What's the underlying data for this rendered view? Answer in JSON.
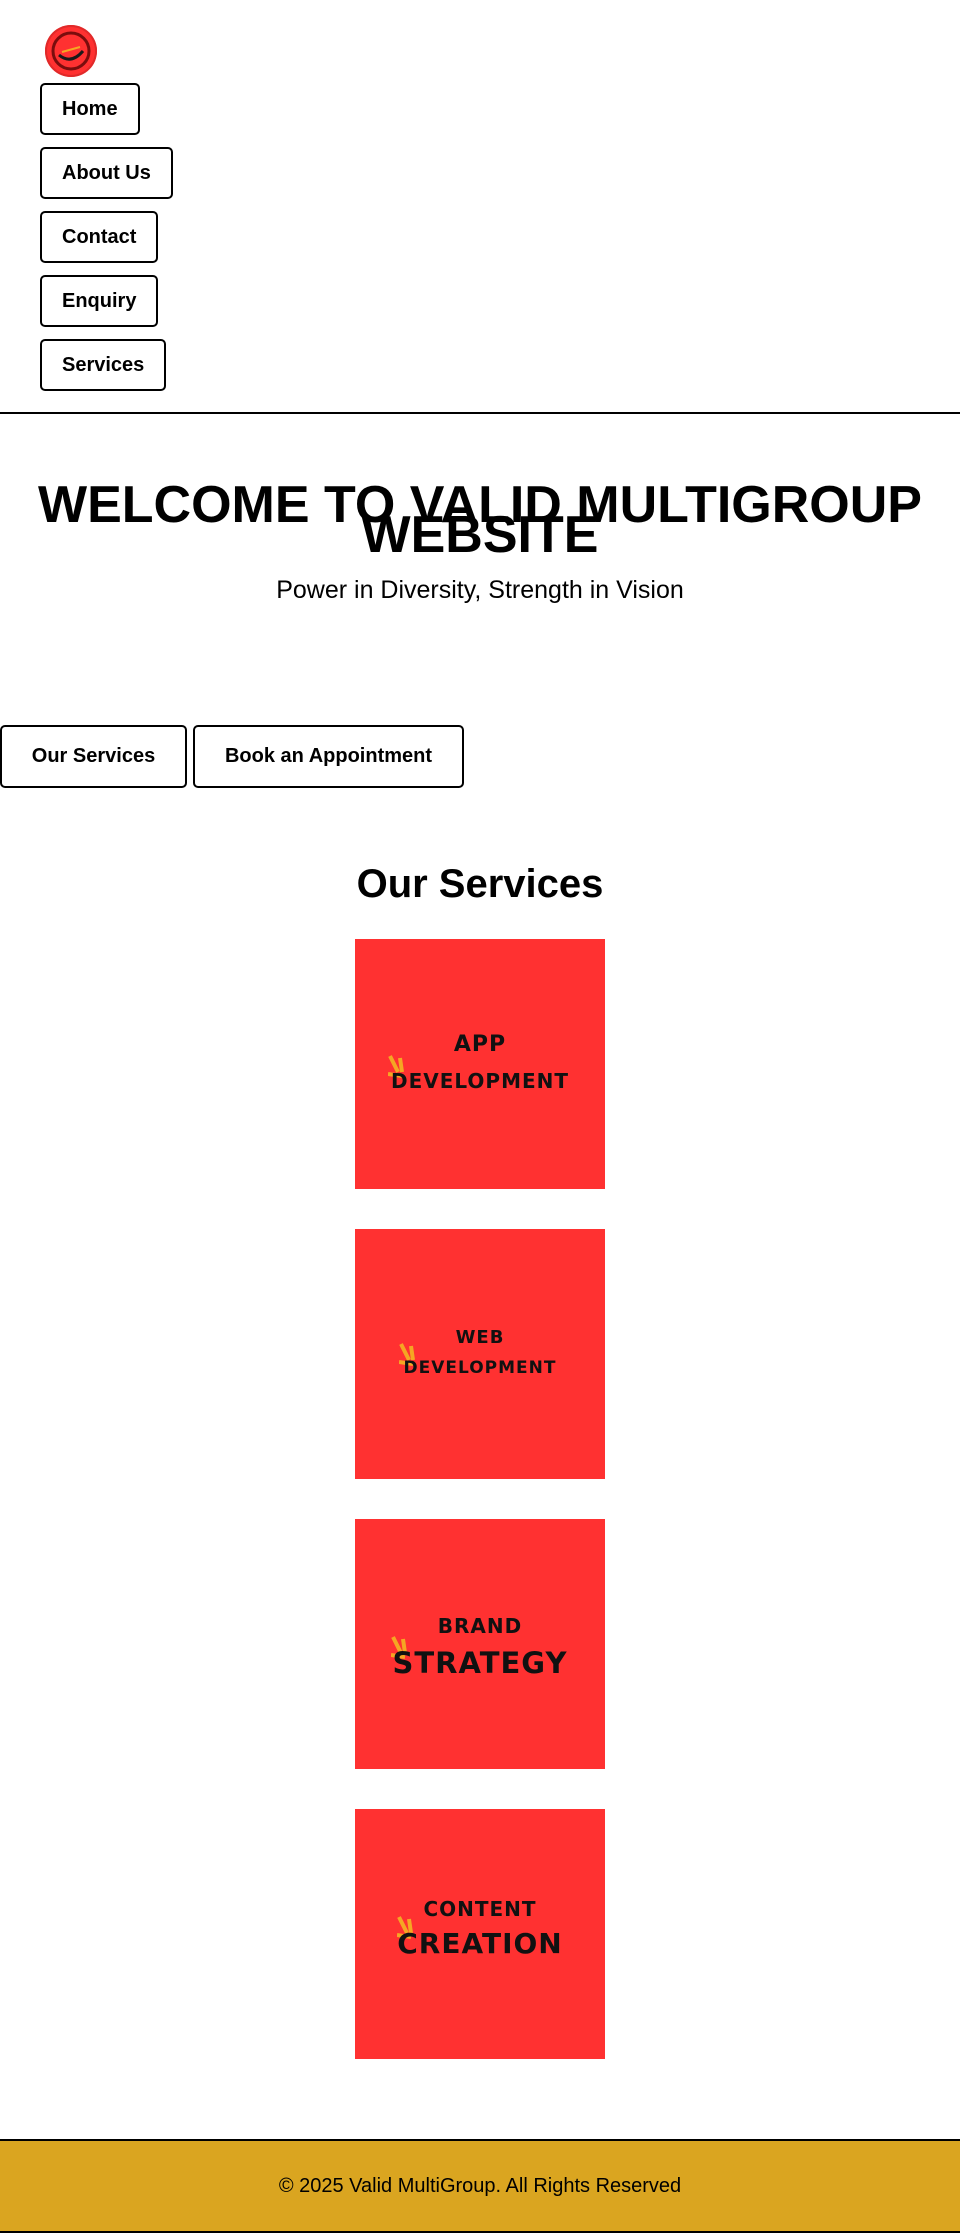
{
  "nav": {
    "items": [
      {
        "label": "Home"
      },
      {
        "label": "About Us"
      },
      {
        "label": "Contact"
      },
      {
        "label": "Enquiry"
      },
      {
        "label": "Services"
      }
    ]
  },
  "hero": {
    "title_line1": "WELCOME TO VALID MULTIGROUP",
    "title_line2": "WEBSITE",
    "subtitle": "Power in Diversity, Strength in Vision",
    "buttons": {
      "services": "Our Services",
      "appointment": "Book an Appointment"
    }
  },
  "services": {
    "title": "Our Services",
    "cards": [
      {
        "line1": "APP",
        "line2": "DEVELOPMENT"
      },
      {
        "line1": "WEB",
        "line2": "DEVELOPMENT"
      },
      {
        "line1": "BRAND",
        "line2": "STRATEGY"
      },
      {
        "line1": "CONTENT",
        "line2": "CREATION"
      }
    ]
  },
  "footer": {
    "text": "© 2025 Valid MultiGroup. All Rights Reserved"
  },
  "colors": {
    "card_bg": "#ff3131",
    "footer_bg": "#daa520",
    "spark": "#f5a623"
  },
  "icons": {
    "logo": "logo-icon",
    "spark": "spark-icon"
  }
}
